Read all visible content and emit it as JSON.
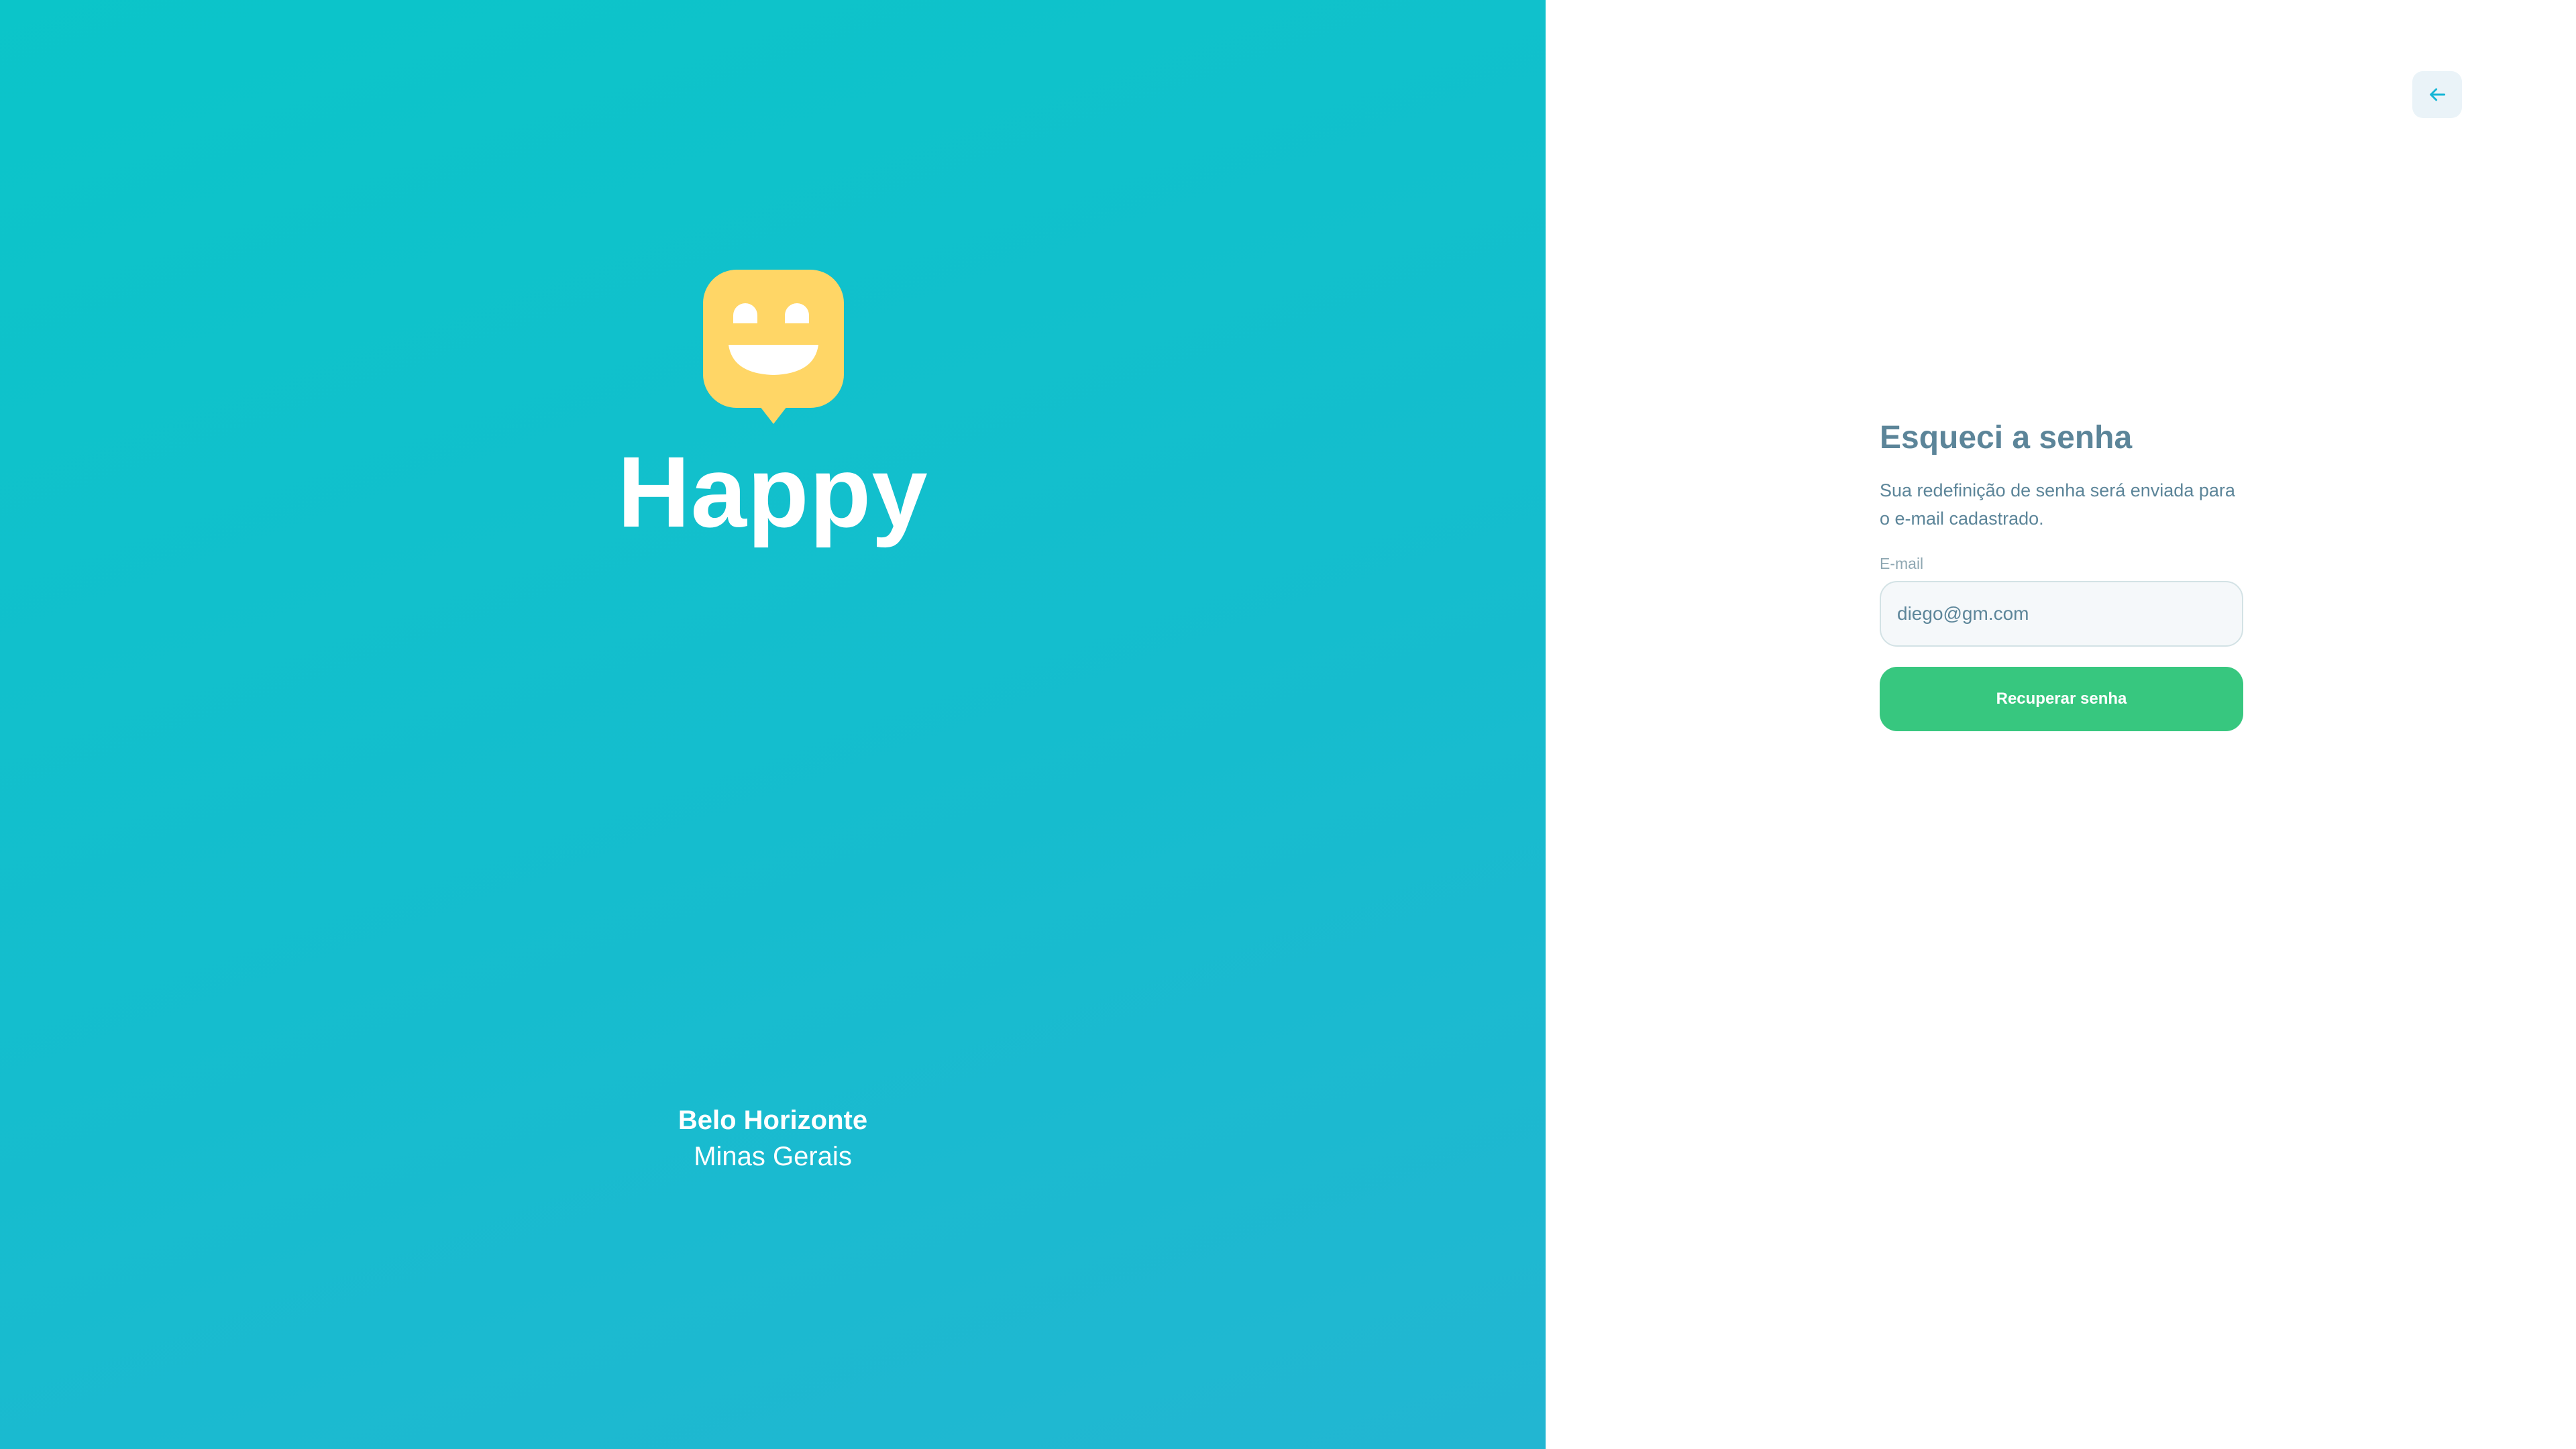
{
  "brand": {
    "name": "Happy",
    "logo_icon": "smiley-chat-bubble-icon",
    "city": "Belo Horizonte",
    "state": "Minas Gerais"
  },
  "header": {
    "back_icon": "arrow-left-icon"
  },
  "form": {
    "title": "Esqueci a senha",
    "description": "Sua redefinição de senha será enviada para o e-mail cadastrado.",
    "email_label": "E-mail",
    "email_value": "diego@gm.com",
    "submit_label": "Recuperar senha"
  },
  "colors": {
    "brand_gradient_start": "#0bc5c9",
    "brand_gradient_end": "#22b6d2",
    "logo_yellow": "#ffd666",
    "text_primary": "#5c8599",
    "label_text": "#8fa7b2",
    "input_background": "#f5f8fa",
    "input_border": "#d3e2e5",
    "button_green": "#37c77f",
    "back_button_background": "#eaf3f8",
    "back_icon_color": "#15b6d6"
  }
}
